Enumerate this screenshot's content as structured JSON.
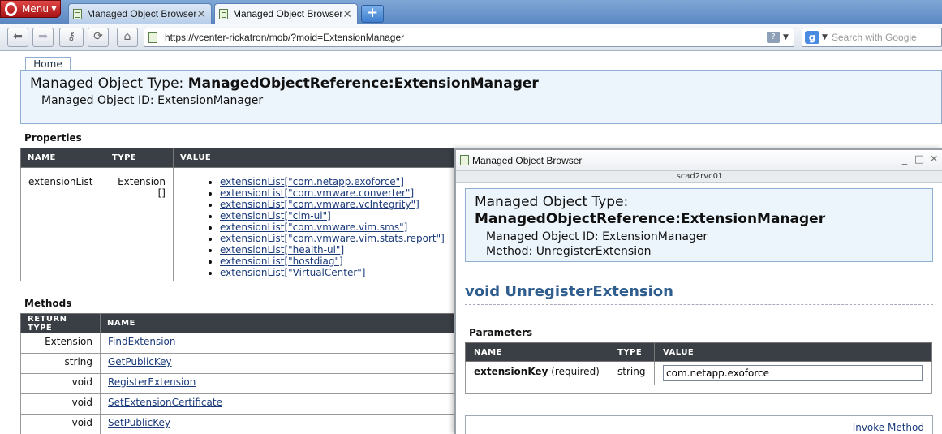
{
  "browser": {
    "menu_label": "Menu",
    "tabs": [
      {
        "label": "Managed Object Browser",
        "active": false
      },
      {
        "label": "Managed Object Browser",
        "active": true
      }
    ],
    "new_tab": "+",
    "url": "https://vcenter-rickatron/mob/?moid=ExtensionManager",
    "search_placeholder": "Search with Google",
    "addr_help": "?"
  },
  "page": {
    "home_tab": "Home",
    "header": {
      "type_label": "Managed Object Type:",
      "type_value": "ManagedObjectReference:ExtensionManager",
      "id_label": "Managed Object ID:",
      "id_value": "ExtensionManager"
    },
    "properties": {
      "title": "Properties",
      "columns": [
        "NAME",
        "TYPE",
        "VALUE"
      ],
      "row": {
        "name": "extensionList",
        "type": "Extension []",
        "values": [
          "extensionList[\"com.netapp.exoforce\"]",
          "extensionList[\"com.vmware.converter\"]",
          "extensionList[\"com.vmware.vcIntegrity\"]",
          "extensionList[\"cim-ui\"]",
          "extensionList[\"com.vmware.vim.sms\"]",
          "extensionList[\"com.vmware.vim.stats.report\"]",
          "extensionList[\"health-ui\"]",
          "extensionList[\"hostdiag\"]",
          "extensionList[\"VirtualCenter\"]"
        ]
      }
    },
    "methods": {
      "title": "Methods",
      "columns": [
        "RETURN TYPE",
        "NAME"
      ],
      "rows": [
        {
          "ret": "Extension",
          "name": "FindExtension"
        },
        {
          "ret": "string",
          "name": "GetPublicKey"
        },
        {
          "ret": "void",
          "name": "RegisterExtension"
        },
        {
          "ret": "void",
          "name": "SetExtensionCertificate"
        },
        {
          "ret": "void",
          "name": "SetPublicKey"
        }
      ]
    }
  },
  "popup": {
    "title": "Managed Object Browser",
    "status": "scad2rvc01",
    "header": {
      "type_label": "Managed Object Type:",
      "type_value": "ManagedObjectReference:ExtensionManager",
      "id_label": "Managed Object ID:",
      "id_value": "ExtensionManager",
      "method_label": "Method:",
      "method_value": "UnregisterExtension"
    },
    "method_signature": "void UnregisterExtension",
    "params_title": "Parameters",
    "param_columns": [
      "NAME",
      "TYPE",
      "VALUE"
    ],
    "param": {
      "name": "extensionKey",
      "qualifier": "(required)",
      "type": "string",
      "value": "com.netapp.exoforce"
    },
    "invoke_label": "Invoke Method"
  }
}
